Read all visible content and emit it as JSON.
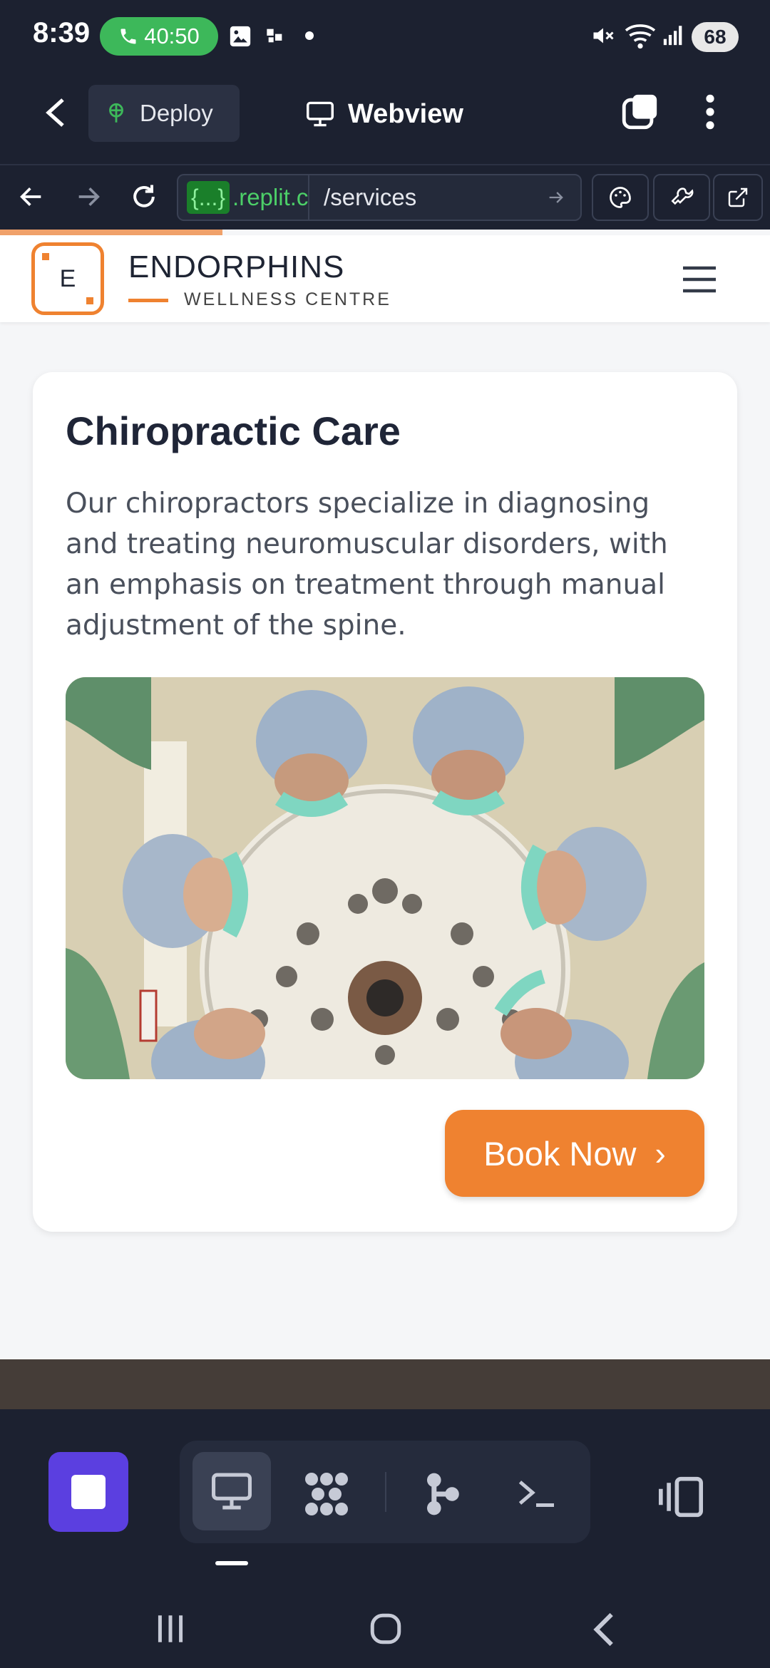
{
  "status_bar": {
    "time": "8:39",
    "call_timer": "40:50",
    "battery": "68"
  },
  "app_header": {
    "deploy_label": "Deploy",
    "title": "Webview"
  },
  "url_bar": {
    "chip": "{...}",
    "domain": ".replit.c",
    "path": "/services"
  },
  "site": {
    "logo_letter": "E",
    "brand_name": "ENDORPHINS",
    "brand_tagline": "WELLNESS CENTRE"
  },
  "service_card": {
    "title": "Chiropractic Care",
    "description": "Our chiropractors specialize in diagnosing and treating neuromuscular disorders, with an emphasis on treatment through manual adjustment of the spine.",
    "cta_label": "Book Now",
    "cta_chevron": "›"
  },
  "colors": {
    "accent": "#ef8230",
    "dark_bg": "#1c2130",
    "stop_button": "#5b3fe0"
  }
}
